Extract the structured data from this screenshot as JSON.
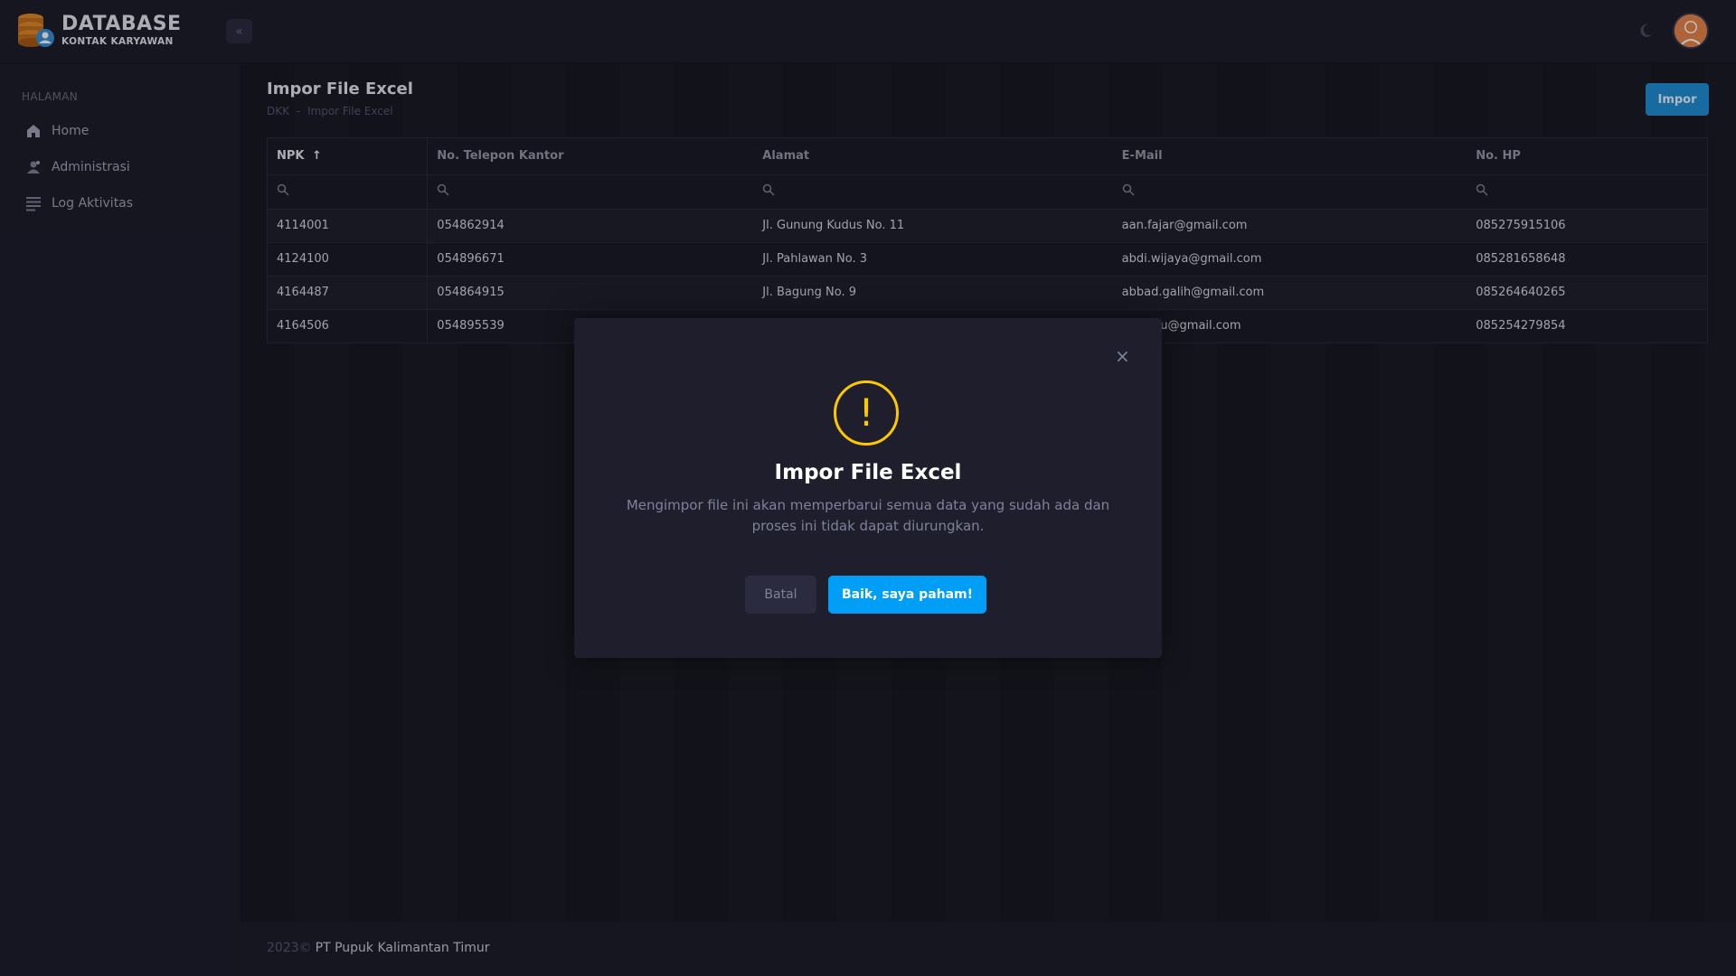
{
  "app": {
    "logo_title": "DATABASE",
    "logo_subtitle": "KONTAK KARYAWAN",
    "collapse_icon": "chevron-double-left-icon",
    "theme_icon": "moon-icon"
  },
  "sidebar": {
    "section_title": "HALAMAN",
    "items": [
      {
        "label": "Home",
        "icon": "home-icon"
      },
      {
        "label": "Administrasi",
        "icon": "user-admin-icon"
      },
      {
        "label": "Log Aktivitas",
        "icon": "list-icon"
      }
    ]
  },
  "page": {
    "title": "Impor File Excel",
    "breadcrumb_root": "DKK",
    "breadcrumb_sep": "-",
    "breadcrumb_current": "Impor File Excel",
    "import_button": "Impor"
  },
  "table": {
    "columns": [
      "NPK",
      "No. Telepon Kantor",
      "Alamat",
      "E-Mail",
      "No. HP"
    ],
    "sort_indicator": "↑",
    "rows": [
      [
        "4114001",
        "054862914",
        "Jl. Gunung Kudus No. 11",
        "aan.fajar@gmail.com",
        "085275915106"
      ],
      [
        "4124100",
        "054896671",
        "Jl. Pahlawan No. 3",
        "abdi.wijaya@gmail.com",
        "085281658648"
      ],
      [
        "4164487",
        "054864915",
        "Jl. Bagung No. 9",
        "abbad.galih@gmail.com",
        "085264640265"
      ],
      [
        "4164506",
        "054895539",
        "",
        "isnu@gmail.com",
        "085254279854"
      ]
    ]
  },
  "footer": {
    "year": "2023©",
    "company": "PT Pupuk Kalimantan Timur"
  },
  "modal": {
    "icon": "warning-icon",
    "icon_glyph": "!",
    "title": "Impor File Excel",
    "message": "Mengimpor file ini akan memperbarui semua data yang sudah ada dan proses ini tidak dapat diurungkan.",
    "cancel_label": "Batal",
    "confirm_label": "Baik, saya paham!",
    "close_glyph": "×"
  },
  "colors": {
    "accent": "#009ef7",
    "warning": "#ffc700",
    "import_button": "#1f8fd6"
  }
}
